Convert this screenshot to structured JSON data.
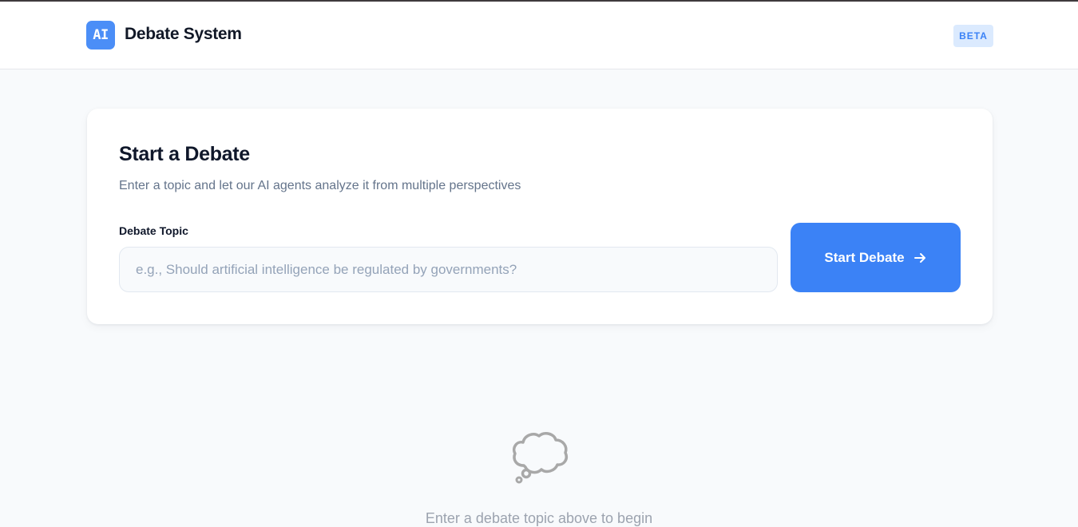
{
  "header": {
    "logo_text": "AI",
    "title": "Debate System",
    "badge": "BETA"
  },
  "card": {
    "title": "Start a Debate",
    "subtitle": "Enter a topic and let our AI agents analyze it from multiple perspectives",
    "field_label": "Debate Topic",
    "input_value": "",
    "input_placeholder": "e.g., Should artificial intelligence be regulated by governments?",
    "button_label": "Start Debate",
    "button_icon": "arrow-right-icon"
  },
  "empty_state": {
    "icon": "thought-bubble-icon",
    "message": "Enter a debate topic above to begin"
  },
  "colors": {
    "accent": "#3b82f6",
    "logo": "#4b8ef7",
    "badge_bg": "#dbeafe",
    "page_bg": "#f8fafc"
  }
}
